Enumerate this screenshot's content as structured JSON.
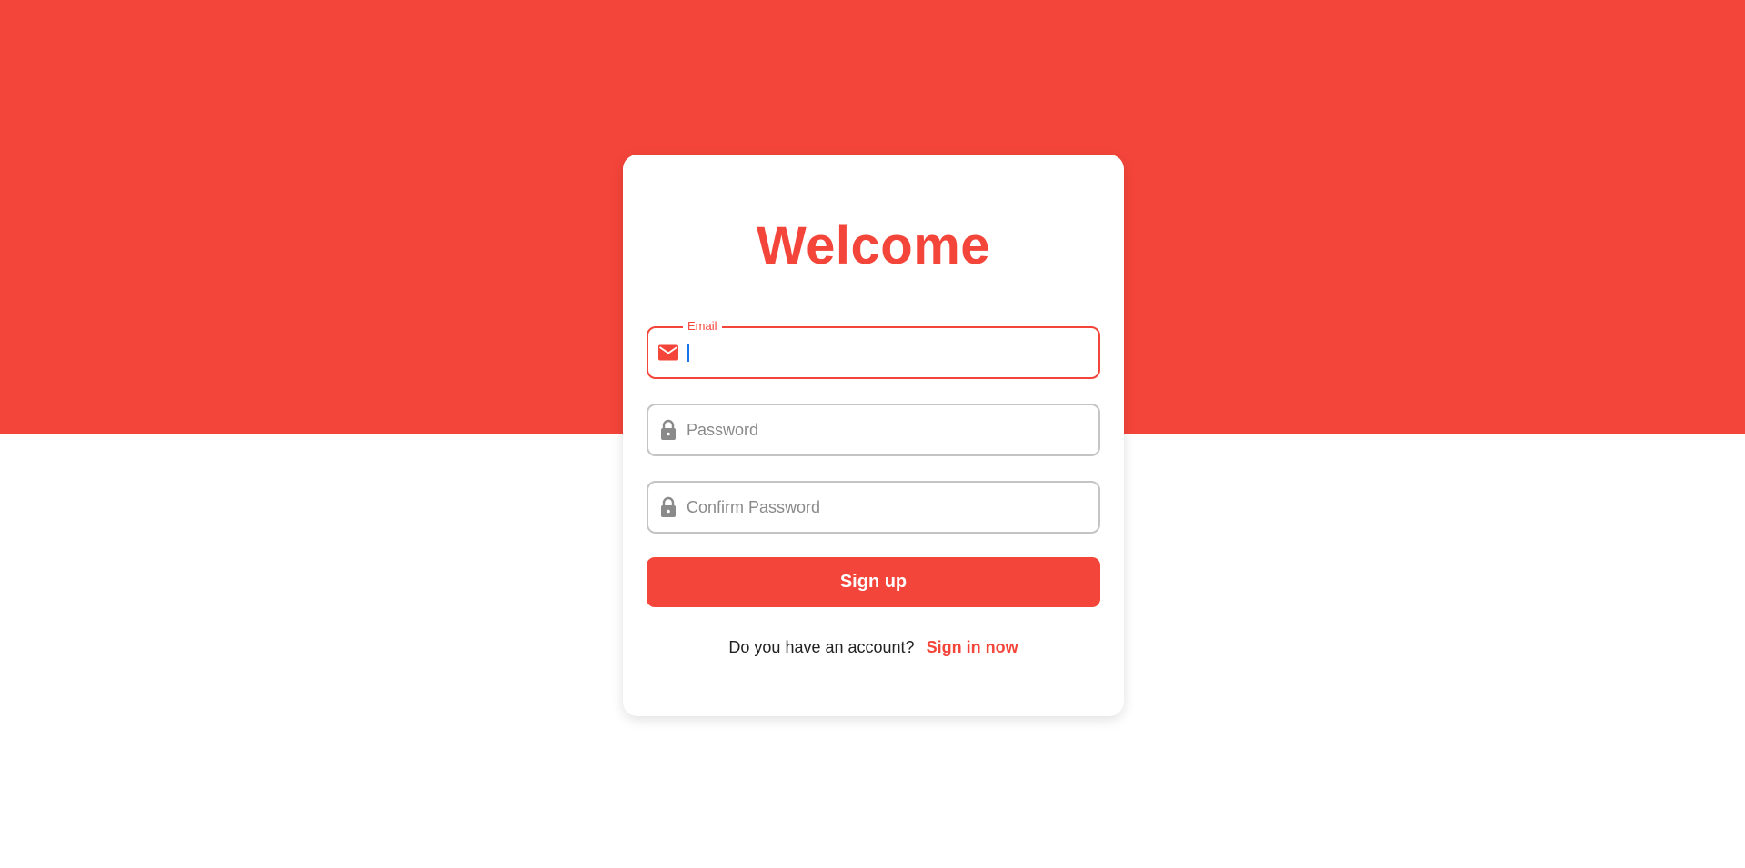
{
  "colors": {
    "brand": "#f4453a",
    "border": "#c4c4c4",
    "icon_inactive": "#8a8a8a",
    "background": "#ffffff"
  },
  "form": {
    "title": "Welcome",
    "email": {
      "label": "Email",
      "value": "",
      "icon": "mail-icon"
    },
    "password": {
      "placeholder": "Password",
      "value": "",
      "icon": "lock-icon"
    },
    "confirm_password": {
      "placeholder": "Confirm Password",
      "value": "",
      "icon": "lock-icon"
    },
    "submit_label": "Sign up",
    "footer_prompt": "Do you have an account?",
    "footer_link": "Sign in now"
  }
}
